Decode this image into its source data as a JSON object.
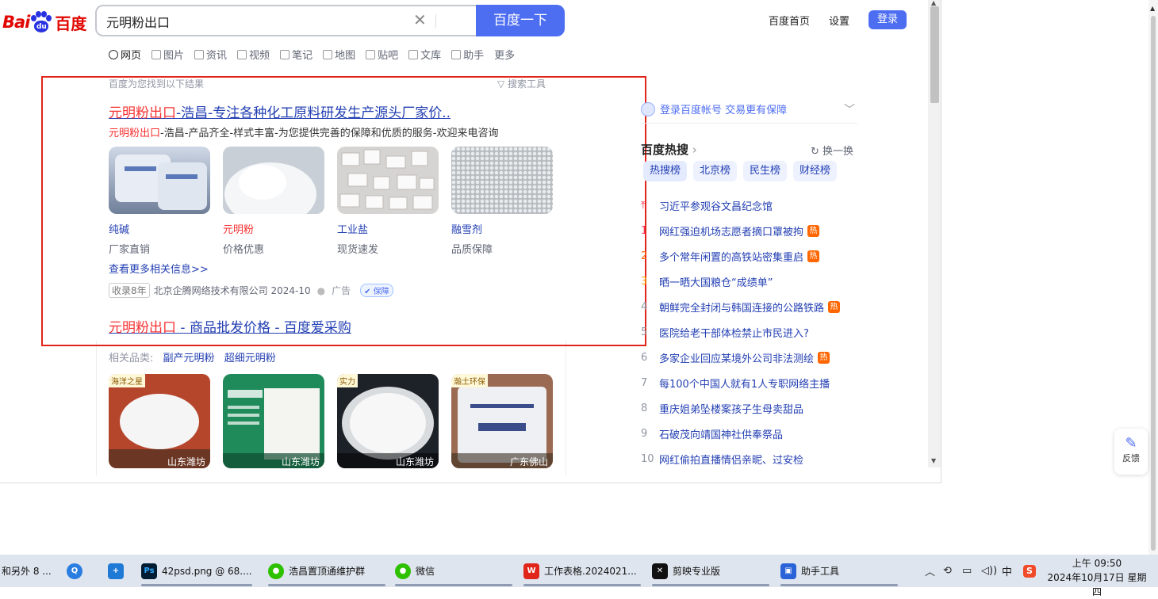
{
  "header": {
    "logo_bai": "Bai",
    "logo_du": "du",
    "logo_cn": "百度",
    "search_value": "元明粉出口",
    "search_button": "百度一下",
    "home_link": "百度首页",
    "settings_link": "设置",
    "login_button": "登录"
  },
  "tabs": [
    "网页",
    "图片",
    "资讯",
    "视频",
    "笔记",
    "地图",
    "贴吧",
    "文库",
    "助手",
    "更多"
  ],
  "result1": {
    "found_text": "百度为您找到以下结果",
    "search_tools": "搜索工具",
    "title_highlight": "元明粉出口",
    "title_rest": "-浩昌-专注各种化工原料研发生产源头厂家价..",
    "desc_highlight": "元明粉出口",
    "desc_rest": "-浩昌-产品齐全-样式丰富-为您提供完善的保障和优质的服务-欢迎来电咨询",
    "thumbs": [
      {
        "name": "纯碱",
        "sub": "厂家直销"
      },
      {
        "name": "元明粉",
        "sub": "价格优惠"
      },
      {
        "name": "工业盐",
        "sub": "现货速发"
      },
      {
        "name": "融雪剂",
        "sub": "品质保障"
      }
    ],
    "more_info": "查看更多相关信息>>",
    "age": "收录8年",
    "company": "北京企腾网络技术有限公司 2024-10",
    "ad": "广告",
    "guarantee": "保障"
  },
  "result2": {
    "title_highlight": "元明粉出口",
    "title_rest": " - 商品批发价格 - 百度爱采购",
    "related_label": "相关品类:",
    "related_links": [
      "副产元明粉",
      "超细元明粉"
    ],
    "products": [
      {
        "tag": "海洋之星",
        "loc": "山东潍坊"
      },
      {
        "tag": "",
        "loc": "山东潍坊"
      },
      {
        "tag": "实力",
        "loc": "山东潍坊"
      },
      {
        "tag": "瀚土环保",
        "loc": "广东佛山"
      }
    ]
  },
  "sidebar": {
    "login_hint": "登录百度帐号 交易更有保障",
    "hot_title": "百度热搜",
    "refresh": "换一换",
    "hot_tabs": [
      "热搜榜",
      "北京榜",
      "民生榜",
      "财经榜"
    ],
    "hot_items": [
      {
        "idx": "",
        "text": "习近平参观谷文昌纪念馆",
        "hot": false
      },
      {
        "idx": "1",
        "text": "网红强迫机场志愿者摘口罩被拘",
        "hot": true
      },
      {
        "idx": "2",
        "text": "多个常年闲置的高铁站密集重启",
        "hot": true
      },
      {
        "idx": "3",
        "text": "晒一晒大国粮仓“成绩单”",
        "hot": false
      },
      {
        "idx": "4",
        "text": "朝鲜完全封闭与韩国连接的公路铁路",
        "hot": true
      },
      {
        "idx": "5",
        "text": "医院给老干部体检禁止市民进入?",
        "hot": false
      },
      {
        "idx": "6",
        "text": "多家企业回应某境外公司非法测绘",
        "hot": true
      },
      {
        "idx": "7",
        "text": "每100个中国人就有1人专职网络主播",
        "hot": false
      },
      {
        "idx": "8",
        "text": "重庆姐弟坠楼案孩子生母卖甜品",
        "hot": false
      },
      {
        "idx": "9",
        "text": "石破茂向靖国神社供奉祭品",
        "hot": false
      },
      {
        "idx": "10",
        "text": "网红偷拍直播情侣亲昵、过安检",
        "hot": false
      }
    ],
    "hot_badge": "热"
  },
  "feedback": "反馈",
  "taskbar": {
    "items": [
      "和另外 8 ...",
      "42psd.png @ 68....",
      "浩昌置顶通维护群",
      "微信",
      "工作表格.2024021...",
      "剪映专业版",
      "助手工具"
    ],
    "ps_icon": "Ps",
    "ime": "中",
    "time": "上午 09:50",
    "date": "2024年10月17日 星期四"
  },
  "colors": {
    "brand_blue": "#4e6ef2",
    "link_blue": "#2440b3",
    "highlight_red": "#f73131",
    "frame_red": "#e1251b",
    "hot_orange": "#ff6600"
  }
}
